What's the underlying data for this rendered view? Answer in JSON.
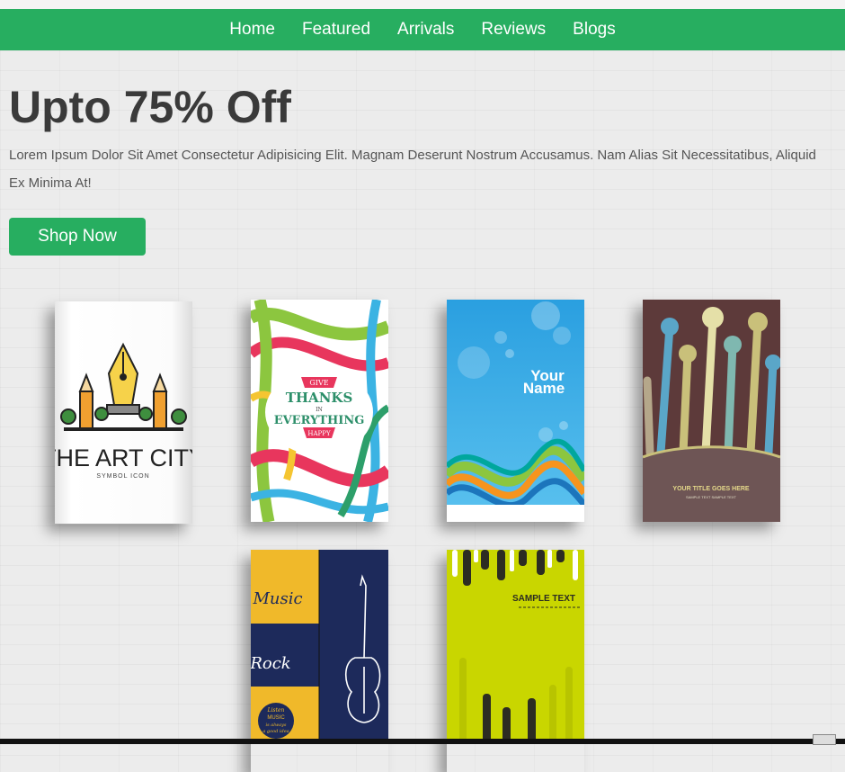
{
  "nav": {
    "items": [
      "Home",
      "Featured",
      "Arrivals",
      "Reviews",
      "Blogs"
    ]
  },
  "hero": {
    "title": "Upto 75% Off",
    "text": "Lorem Ipsum Dolor Sit Amet Consectetur Adipisicing Elit. Magnam Deserunt Nostrum Accusamus. Nam Alias Sit Necessitatibus, Aliquid Ex Minima At!",
    "button_label": "Shop Now"
  },
  "books": {
    "art_city": {
      "title": "THE ART CITY",
      "subtitle": "SYMBOL ICON"
    },
    "thanks": {
      "line1": "GIVE",
      "line2": "THANKS",
      "line3": "IN",
      "line4": "EVERYTHING",
      "line5": "HAPPY"
    },
    "your_name": {
      "line1": "Your",
      "line2": "Name"
    },
    "hands": {
      "title": "YOUR TITLE GOES HERE",
      "subtitle": "SAMPLE TEXT SAMPLE TEXT"
    },
    "music": {
      "word1": "Music",
      "word2": "Rock",
      "badge1": "Listen",
      "badge2": "MUSIC",
      "badge3": "is always",
      "badge4": "a good idea"
    },
    "sample": {
      "title": "SAMPLE TEXT"
    }
  },
  "colors": {
    "brand_green": "#27ae60",
    "heading": "#3a3a3a",
    "body_text": "#555555"
  }
}
